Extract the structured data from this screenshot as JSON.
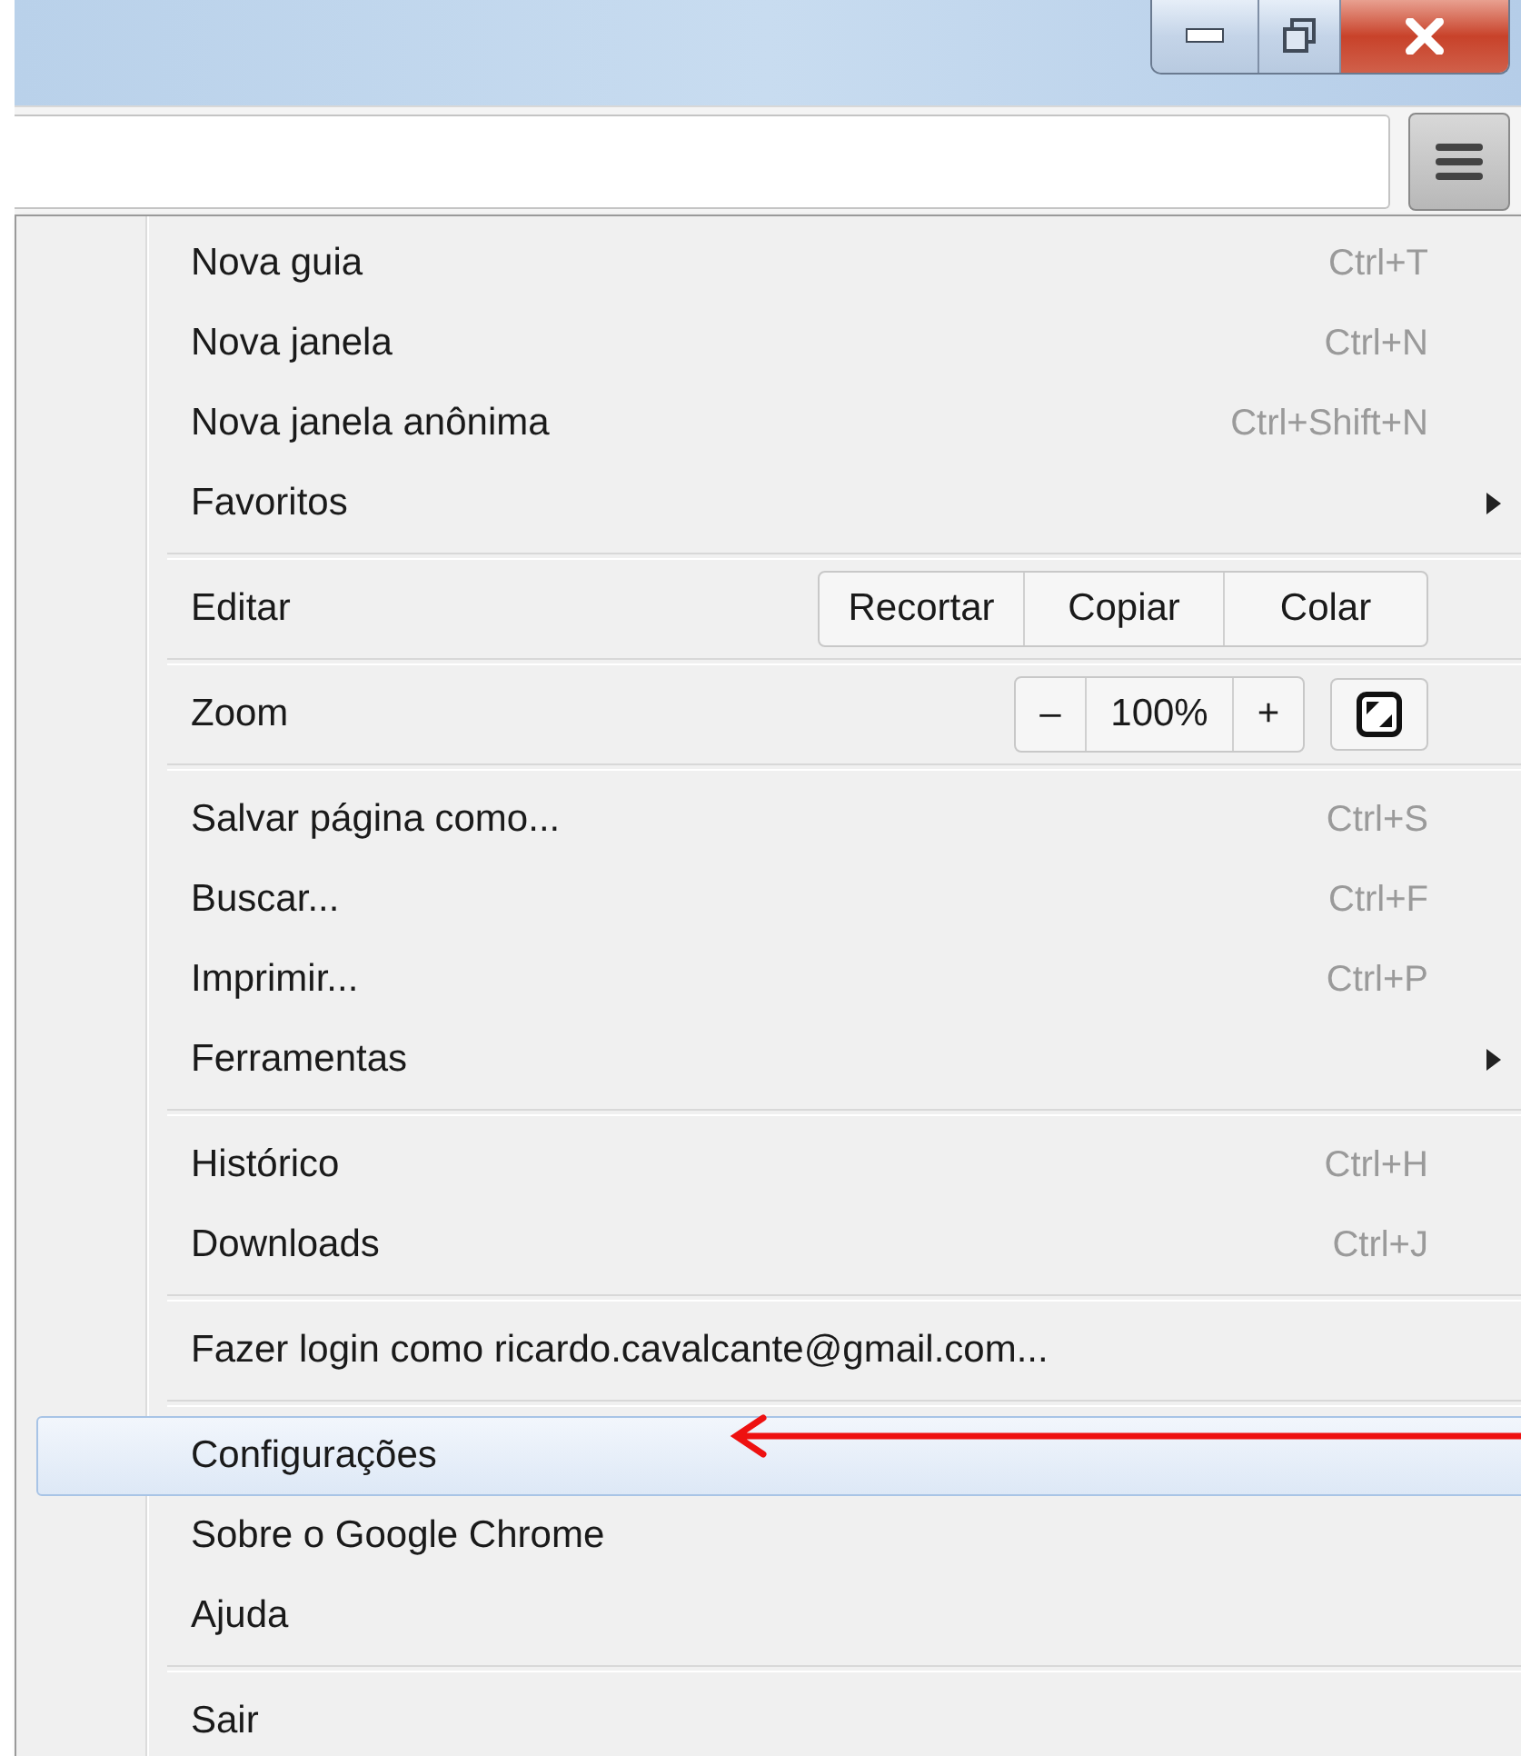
{
  "menu": [
    {
      "kind": "item",
      "label": "Nova guia",
      "shortcut": "Ctrl+T",
      "selected": false
    },
    {
      "kind": "item",
      "label": "Nova janela",
      "shortcut": "Ctrl+N",
      "selected": false
    },
    {
      "kind": "item",
      "label": "Nova janela anônima",
      "shortcut": "Ctrl+Shift+N",
      "selected": false
    },
    {
      "kind": "submenu",
      "label": "Favoritos",
      "selected": false
    },
    {
      "kind": "separator"
    },
    {
      "kind": "edit",
      "label": "Editar",
      "buttons": [
        "Recortar",
        "Copiar",
        "Colar"
      ]
    },
    {
      "kind": "separator"
    },
    {
      "kind": "zoom",
      "label": "Zoom",
      "minus": "–",
      "value": "100%",
      "plus": "+"
    },
    {
      "kind": "separator"
    },
    {
      "kind": "item",
      "label": "Salvar página como...",
      "shortcut": "Ctrl+S",
      "selected": false
    },
    {
      "kind": "item",
      "label": "Buscar...",
      "shortcut": "Ctrl+F",
      "selected": false
    },
    {
      "kind": "item",
      "label": "Imprimir...",
      "shortcut": "Ctrl+P",
      "selected": false
    },
    {
      "kind": "submenu",
      "label": "Ferramentas",
      "selected": false
    },
    {
      "kind": "separator"
    },
    {
      "kind": "item",
      "label": "Histórico",
      "shortcut": "Ctrl+H",
      "selected": false
    },
    {
      "kind": "item",
      "label": "Downloads",
      "shortcut": "Ctrl+J",
      "selected": false
    },
    {
      "kind": "separator"
    },
    {
      "kind": "item",
      "label": "Fazer login como ricardo.cavalcante@gmail.com...",
      "selected": false
    },
    {
      "kind": "separator"
    },
    {
      "kind": "item",
      "label": "Configurações",
      "selected": true
    },
    {
      "kind": "item",
      "label": "Sobre o Google Chrome",
      "selected": false
    },
    {
      "kind": "item",
      "label": "Ajuda",
      "selected": false
    },
    {
      "kind": "separator"
    },
    {
      "kind": "item",
      "label": "Sair",
      "selected": false
    }
  ]
}
